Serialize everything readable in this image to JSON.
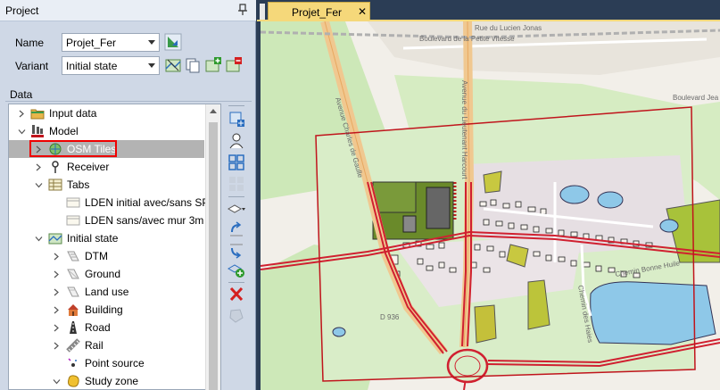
{
  "panel": {
    "title": "Project"
  },
  "project": {
    "name_label": "Name",
    "name_value": "Projet_Fer",
    "variant_label": "Variant",
    "variant_value": "Initial state"
  },
  "data_section": {
    "label": "Data"
  },
  "tree": {
    "input_data": "Input data",
    "model": "Model",
    "osm_tiles": "OSM Tiles",
    "receiver": "Receiver",
    "tabs": "Tabs",
    "tab1": "LDEN initial avec/sans SP",
    "tab2": "LDEN sans/avec mur 3m",
    "initial_state": "Initial state",
    "dtm": "DTM",
    "ground": "Ground",
    "land_use": "Land use",
    "building": "Building",
    "road": "Road",
    "rail": "Rail",
    "point_source": "Point source",
    "study_zone": "Study zone"
  },
  "document": {
    "tab_title": "Projet_Fer",
    "close_glyph": "✕"
  },
  "map": {
    "labels": {
      "street_top1": "Rue du Lucien Jonas",
      "street_top2": "Boulevard de la Petite Vitesse",
      "avenue_left": "Avenue Charles de Gaulle",
      "avenue_center": "Avenue du Lieutenant Harcourt",
      "boulevard_right": "Boulevard Jea",
      "chemin1": "Chemin Bonne Huile",
      "chemin2": "Chemin des Haies",
      "road_ref": "D 936"
    },
    "colors": {
      "study_zone": "#c0141c",
      "road_main": "#d02030",
      "vegetation": "#b6d89a",
      "water": "#8ec8e8"
    }
  }
}
